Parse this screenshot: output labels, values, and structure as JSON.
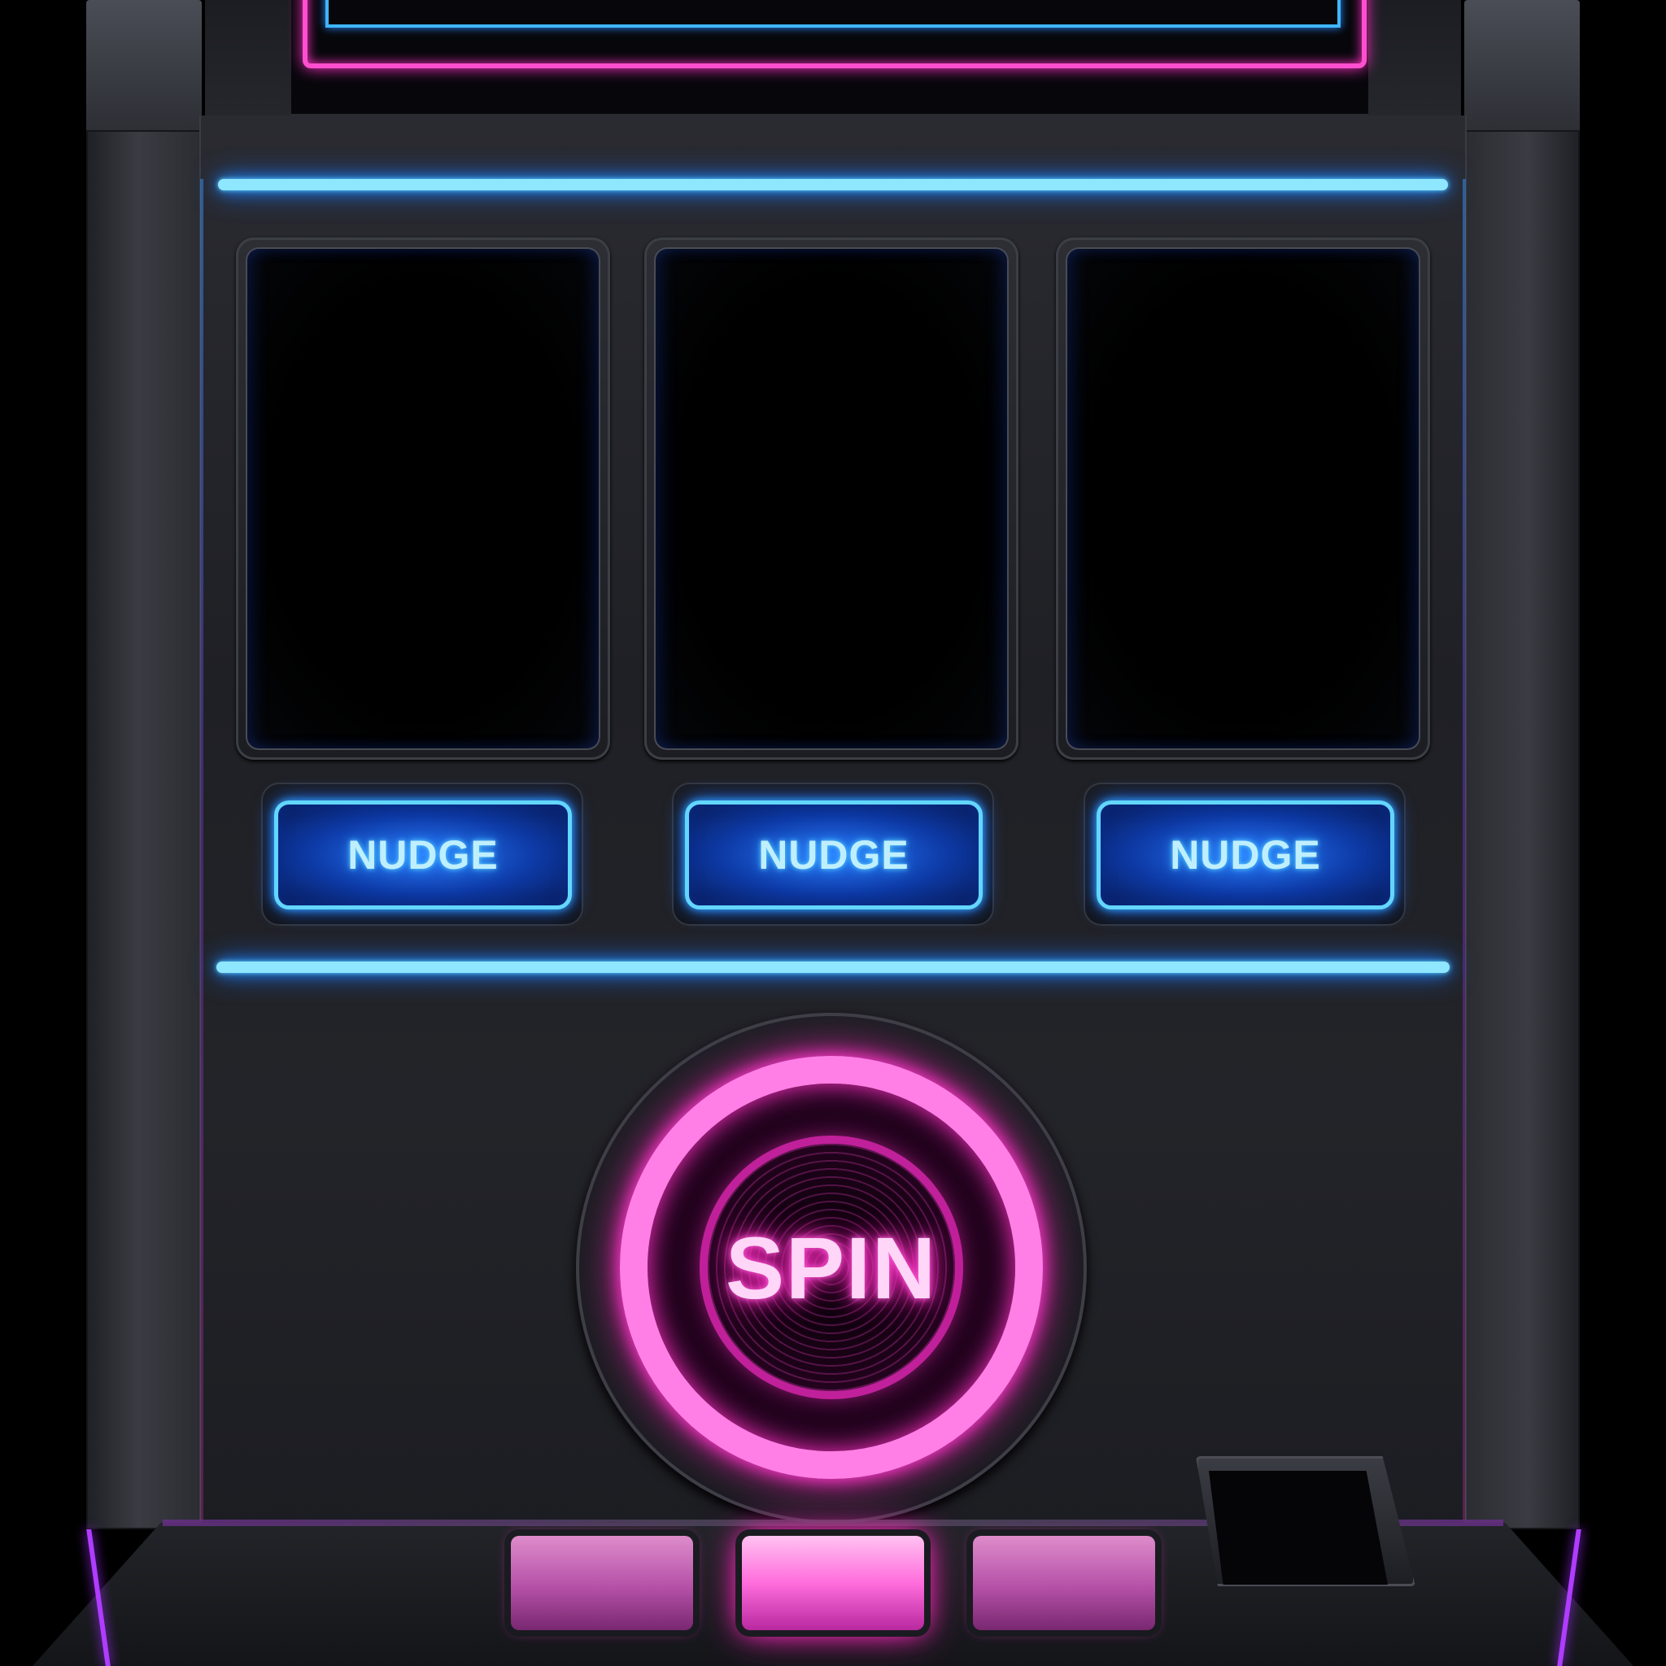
{
  "reels": {
    "count": 3
  },
  "nudge_buttons": [
    {
      "label": "NUDGE"
    },
    {
      "label": "NUDGE"
    },
    {
      "label": "NUDGE"
    }
  ],
  "spin_button": {
    "label": "SPIN"
  },
  "deck_buttons": {
    "count": 3,
    "active_index": 1
  },
  "colors": {
    "neon_blue": "#63d6ff",
    "neon_pink": "#ff4fd0",
    "cabinet": "#23242a",
    "background": "#000000"
  },
  "icons": {
    "bill_slot": "bill-acceptor-icon"
  }
}
